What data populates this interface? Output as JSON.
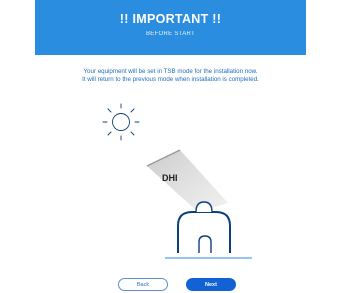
{
  "header": {
    "title": "!! IMPORTANT !!",
    "subtitle": "BEFORE START"
  },
  "message": {
    "line1": "Your equipment will be set in TSB mode for the installation now.",
    "line2": "It will return to the previous mode when installation is completed."
  },
  "illustration": {
    "beam_label": "DHI",
    "icons": [
      "sun-icon",
      "solar-tracker-icon"
    ]
  },
  "buttons": {
    "back_label": "Back",
    "next_label": "Next"
  },
  "colors": {
    "header": "#2a8de0",
    "text_accent": "#1f6fbd",
    "primary_button": "#1262d6",
    "illustration_line": "#0d3f7a"
  }
}
